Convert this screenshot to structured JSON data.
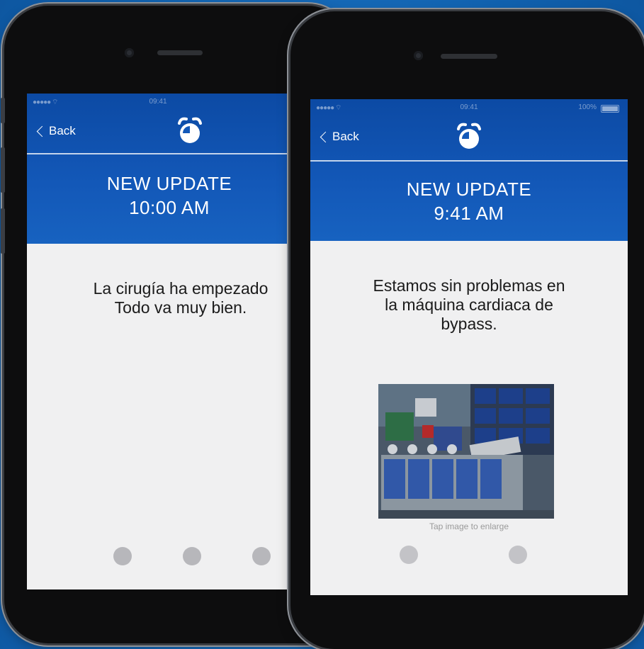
{
  "status_bar": {
    "carrier": "●●●●● ⌔",
    "time": "09:41",
    "battery": "100%"
  },
  "nav": {
    "back_label": "Back"
  },
  "left_screen": {
    "update_title": "NEW UPDATE",
    "update_time": "10:00 AM",
    "message_line1": "La cirugía ha empezado",
    "message_line2": "Todo va muy bien."
  },
  "right_screen": {
    "update_title": "NEW UPDATE",
    "update_time": "9:41 AM",
    "message_line1": "Estamos sin problemas en",
    "message_line2": "la máquina cardiaca de",
    "message_line3": "bypass.",
    "image_caption": "Tap image to enlarge"
  },
  "icons": {
    "header_icon": "alarm-clock-icon",
    "back_icon": "chevron-left-icon"
  },
  "colors": {
    "background": "#1161ae",
    "header_blue": "#1358b8",
    "screen_bg": "#f0f0f1"
  }
}
